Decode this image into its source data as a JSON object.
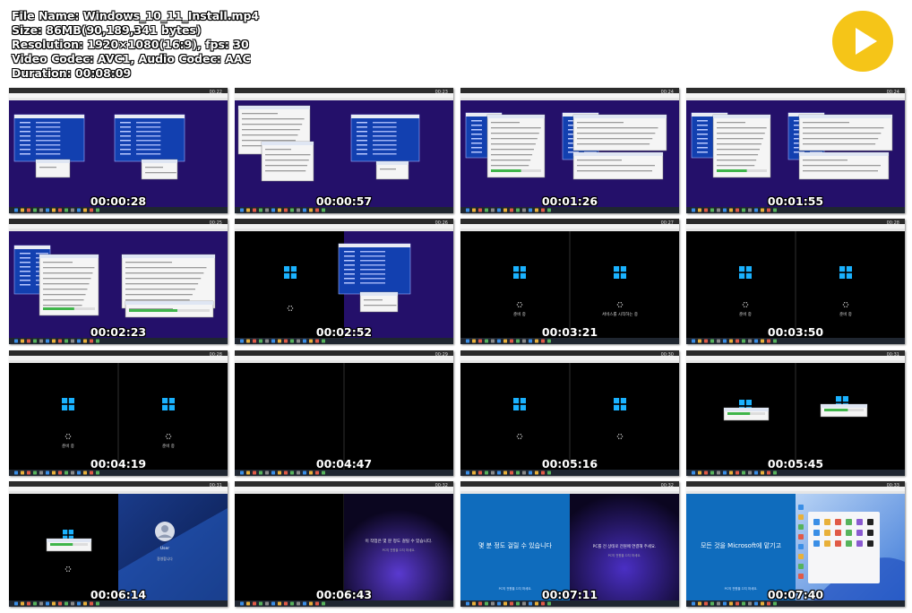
{
  "file_info": {
    "file_name": "File Name: Windows_10_11_Install.mp4",
    "size": "Size: 86MB(90,189,341 bytes)",
    "resolution": "Resolution: 1920×1080(16:9), fps: 30",
    "codecs": "Video Codec: AVC1, Audio Codec: AAC",
    "duration": "Duration: 00:08:09"
  },
  "play_button": {
    "icon": "play-icon",
    "color": "#f5c518"
  },
  "thumbnails": [
    {
      "timestamp": "00:00:28",
      "clock": "00:22",
      "scene": "setup-dialogs"
    },
    {
      "timestamp": "00:00:57",
      "clock": "00:23",
      "scene": "setup-explorer"
    },
    {
      "timestamp": "00:01:26",
      "clock": "00:24",
      "scene": "setup-tools"
    },
    {
      "timestamp": "00:01:55",
      "clock": "00:24",
      "scene": "setup-tools"
    },
    {
      "timestamp": "00:02:23",
      "clock": "00:25",
      "scene": "setup-progress"
    },
    {
      "timestamp": "00:02:52",
      "clock": "00:26",
      "scene": "boot-and-setup"
    },
    {
      "timestamp": "00:03:21",
      "clock": "00:27",
      "scene": "boot-logos",
      "captions": [
        "준비 중",
        "서비스를 시작하는 중"
      ]
    },
    {
      "timestamp": "00:03:50",
      "clock": "00:28",
      "scene": "boot-logos",
      "captions": [
        "준비 중",
        "준비 중"
      ]
    },
    {
      "timestamp": "00:04:19",
      "clock": "00:28",
      "scene": "boot-logos",
      "captions": [
        "준비 중",
        "준비 중"
      ]
    },
    {
      "timestamp": "00:04:47",
      "clock": "00:29",
      "scene": "black"
    },
    {
      "timestamp": "00:05:16",
      "clock": "00:30",
      "scene": "boot-logos",
      "captions": [
        "",
        ""
      ]
    },
    {
      "timestamp": "00:05:45",
      "clock": "00:31",
      "scene": "boot-progress"
    },
    {
      "timestamp": "00:06:14",
      "clock": "00:31",
      "scene": "login",
      "login_user": "User",
      "login_status": "환영합니다"
    },
    {
      "timestamp": "00:06:43",
      "clock": "00:32",
      "scene": "purple-message",
      "message": "이 작업은 몇 분 정도 걸릴 수 있습니다.",
      "sub": "PC의 전원을 끄지 마세요."
    },
    {
      "timestamp": "00:07:11",
      "clock": "00:32",
      "scene": "blue-and-purple",
      "left_message": "몇 분 정도 걸릴 수 있습니다",
      "right_message": "PC를 전 상태로 전원에 연결해 주세요.",
      "sub": "PC의 전원을 끄지 마세요."
    },
    {
      "timestamp": "00:07:40",
      "clock": "00:33",
      "scene": "desktop",
      "left_message": "모든 것을 Microsoft에 맡기고",
      "sub": "PC의 전원을 끄지 마세요."
    }
  ],
  "colors": {
    "accent_blue": "#1e90ff",
    "win_logo": "#1ab2ff",
    "purple_bg": "#2a1670",
    "setup_blue": "#1240b0",
    "oobe_blue": "#0f6cbd"
  }
}
